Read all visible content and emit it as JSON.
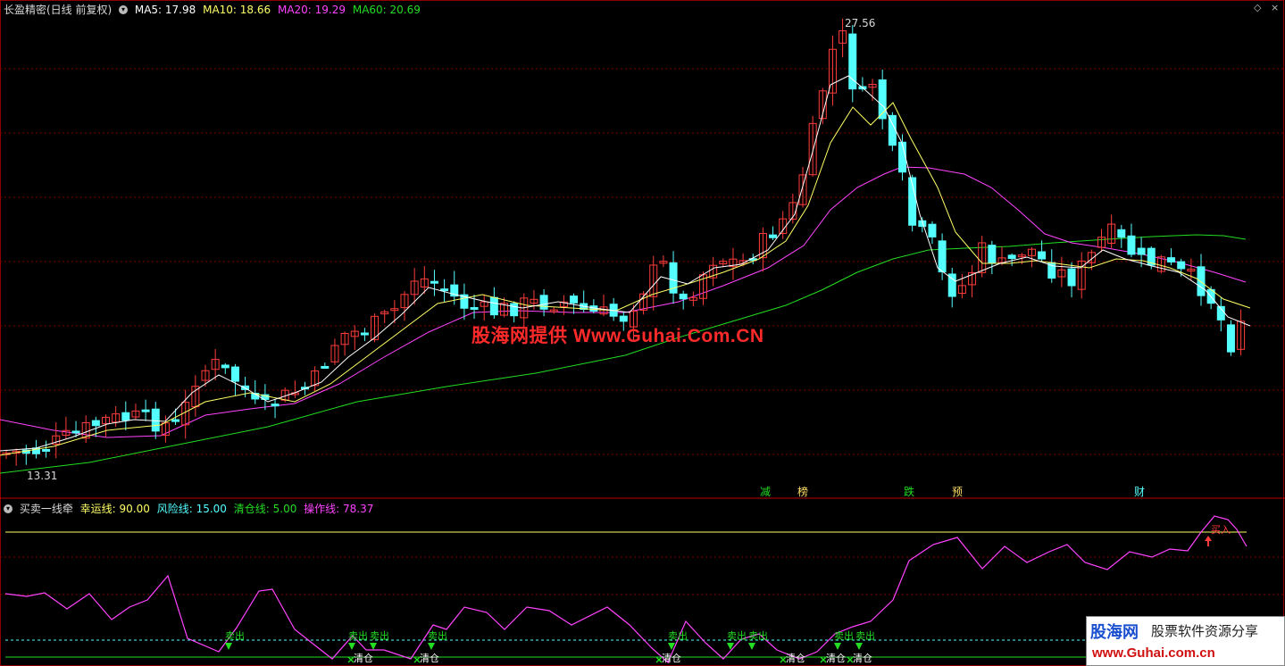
{
  "main_header": {
    "title": "长盈精密(日线 前复权)",
    "ma5": "MA5: 17.98",
    "ma10": "MA10: 18.66",
    "ma20": "MA20: 19.29",
    "ma60": "MA60: 20.69"
  },
  "window_controls": {
    "diamond": "◇",
    "close": "×"
  },
  "price_labels": {
    "high": "27.56",
    "low": "13.31"
  },
  "watermark": "股海网提供 Www.Guhai.Com.CN",
  "event_markers": [
    "减",
    "榜",
    "跌",
    "预",
    "财"
  ],
  "indicator_header": {
    "name": "买卖一线牵",
    "lucky": "幸运线: 90.00",
    "risk": "风险线: 15.00",
    "clear": "清仓线: 5.00",
    "operate": "操作线: 78.37"
  },
  "signal_labels": {
    "sell": "卖出",
    "clear": "清仓",
    "buy": "买入"
  },
  "logo": {
    "brand": "股海网",
    "tagline": "股票软件资源分享",
    "url": "www.Guhai.com.cn"
  },
  "colors": {
    "up": "#ff3c3c",
    "down": "#54ffff",
    "ma5": "#ffffff",
    "ma10": "#ffff66",
    "ma20": "#ff44ff",
    "ma60": "#22dd22",
    "grid": "#800000",
    "separator": "#c00000"
  },
  "chart_data": {
    "type": "candlestick",
    "price_range": [
      13.31,
      27.56
    ],
    "ma_current": {
      "MA5": 17.98,
      "MA10": 18.66,
      "MA20": 19.29,
      "MA60": 20.69
    },
    "indicator": {
      "name": "买卖一线牵",
      "lines": {
        "幸运线": 90.0,
        "风险线": 15.0,
        "清仓线": 5.0,
        "操作线": 78.37
      }
    }
  }
}
